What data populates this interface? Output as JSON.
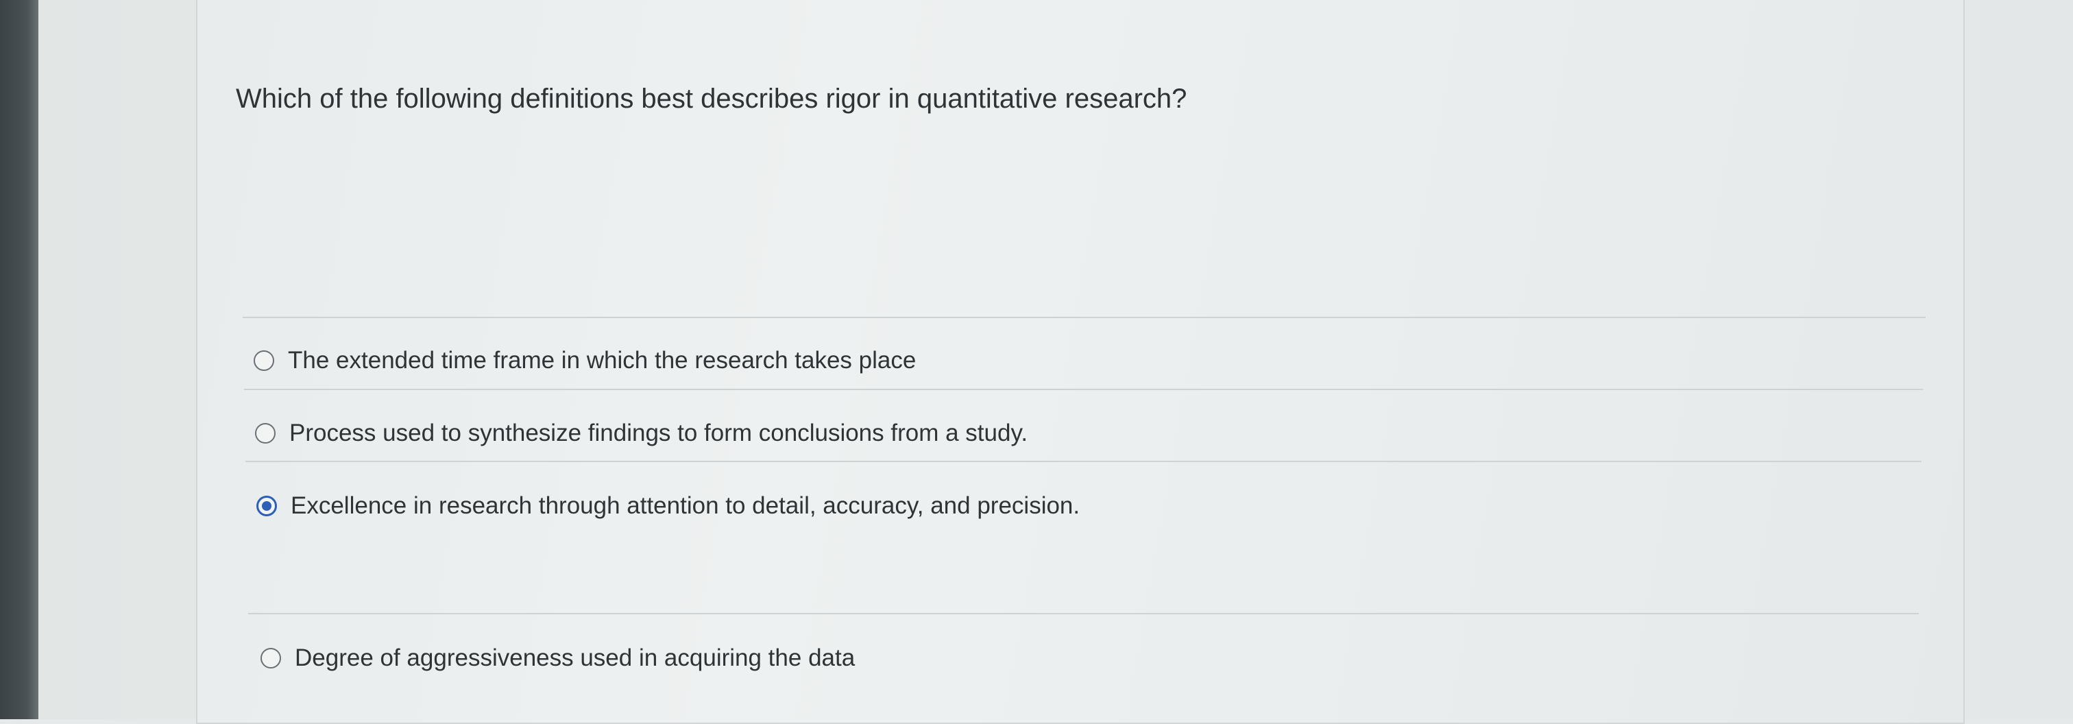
{
  "question": {
    "text": "Which of the following definitions best describes rigor in quantitative research?"
  },
  "options": [
    {
      "label": "The extended time frame in which the research takes place",
      "selected": false
    },
    {
      "label": "Process used to synthesize findings to form conclusions from a study.",
      "selected": false
    },
    {
      "label": "Excellence in research through attention to detail, accuracy, and precision.",
      "selected": true
    },
    {
      "label": "Degree of aggressiveness used in acquiring the data",
      "selected": false
    }
  ],
  "colors": {
    "selected_radio": "#2c5fb8",
    "text": "#2f3336"
  }
}
